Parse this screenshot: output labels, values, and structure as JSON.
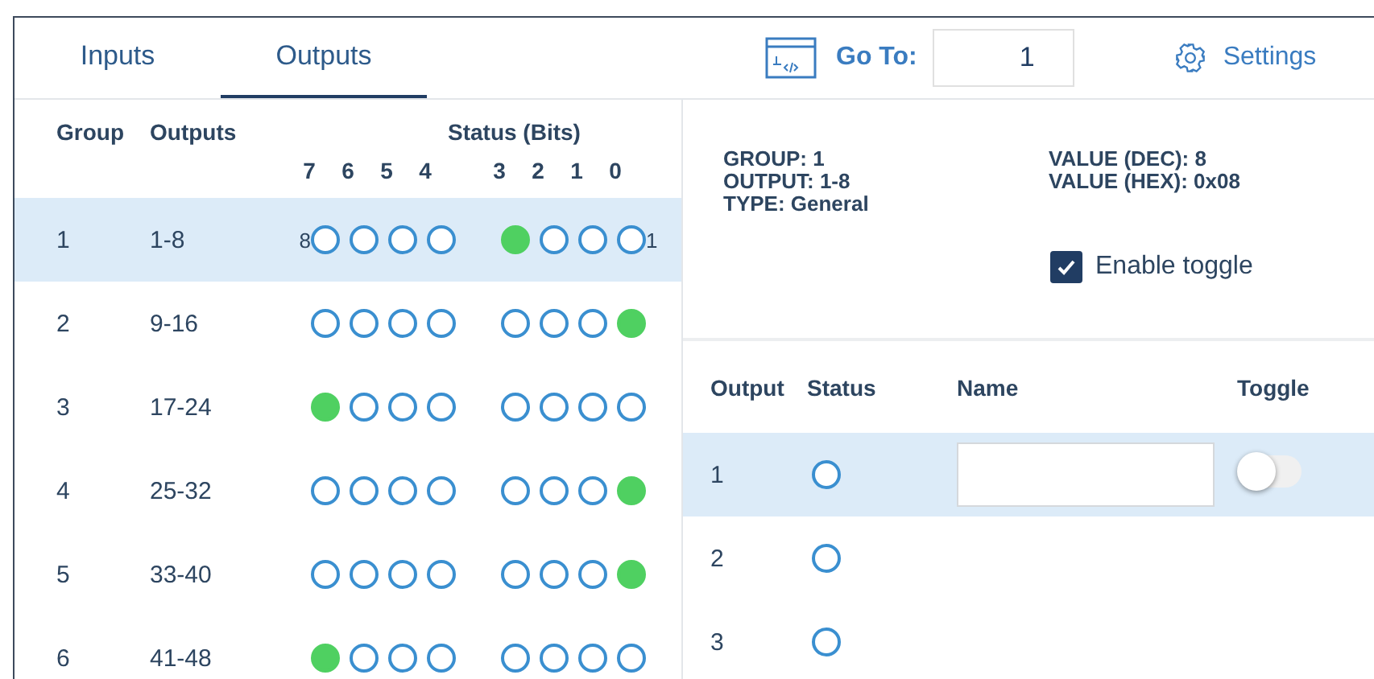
{
  "tabs": [
    {
      "label": "Inputs",
      "selected": false
    },
    {
      "label": "Outputs",
      "selected": true
    }
  ],
  "goto": {
    "label": "Go To:",
    "value": "1"
  },
  "settings": {
    "label": "Settings"
  },
  "groups_table": {
    "columns": [
      "Group",
      "Outputs",
      "Status (Bits)"
    ],
    "bit_headers": [
      "7",
      "6",
      "5",
      "4",
      "3",
      "2",
      "1",
      "0"
    ],
    "rows": [
      {
        "group": "1",
        "outputs": "1-8",
        "selected": true,
        "left_label": "8",
        "right_label": "1",
        "bits": [
          false,
          false,
          false,
          false,
          true,
          false,
          false,
          false
        ]
      },
      {
        "group": "2",
        "outputs": "9-16",
        "selected": false,
        "bits": [
          false,
          false,
          false,
          false,
          false,
          false,
          false,
          true
        ]
      },
      {
        "group": "3",
        "outputs": "17-24",
        "selected": false,
        "bits": [
          true,
          false,
          false,
          false,
          false,
          false,
          false,
          false
        ]
      },
      {
        "group": "4",
        "outputs": "25-32",
        "selected": false,
        "bits": [
          false,
          false,
          false,
          false,
          false,
          false,
          false,
          true
        ]
      },
      {
        "group": "5",
        "outputs": "33-40",
        "selected": false,
        "bits": [
          false,
          false,
          false,
          false,
          false,
          false,
          false,
          true
        ]
      },
      {
        "group": "6",
        "outputs": "41-48",
        "selected": false,
        "bits": [
          true,
          false,
          false,
          false,
          false,
          false,
          false,
          false
        ]
      }
    ]
  },
  "details": {
    "left": [
      "GROUP: 1",
      "OUTPUT: 1-8",
      "TYPE: General"
    ],
    "right": [
      "VALUE (DEC): 8",
      "VALUE (HEX): 0x08"
    ],
    "enable_toggle": {
      "label": "Enable toggle",
      "checked": true
    }
  },
  "outputs_table": {
    "columns": [
      "Output",
      "Status",
      "Name",
      "Toggle"
    ],
    "rows": [
      {
        "output": "1",
        "status": false,
        "selected": true,
        "name_field": true,
        "toggle": {
          "on": false
        }
      },
      {
        "output": "2",
        "status": false,
        "selected": false
      },
      {
        "output": "3",
        "status": false,
        "selected": false
      }
    ]
  }
}
